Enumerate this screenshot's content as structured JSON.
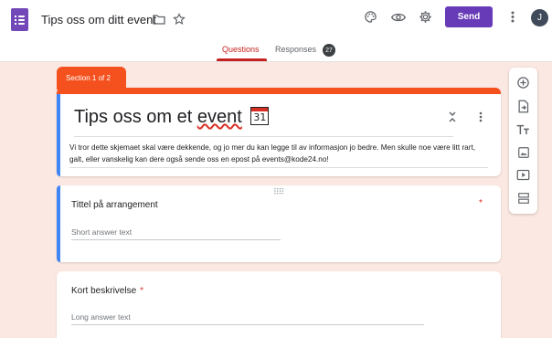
{
  "header": {
    "form_title": "Tips oss om ditt event",
    "send_label": "Send",
    "avatar_letter": "J"
  },
  "tabs": [
    {
      "label": "Questions",
      "active": true
    },
    {
      "label": "Responses",
      "active": false,
      "count": "27"
    }
  ],
  "section": {
    "label": "Section 1 of 2",
    "title_part1": "Tips oss om et",
    "title_part2": "event",
    "calendar_day": "31",
    "description": "Vi tror dette skjemaet skal være dekkende, og jo mer du kan legge til av informasjon jo bedre. Men skulle noe være litt rart, galt, eller vanskelig kan dere også sende oss en epost på events@kode24.no!"
  },
  "questions": [
    {
      "title": "Tittel på arrangement",
      "required": true,
      "hint": "Short answer text"
    },
    {
      "title": "Kort beskrivelse",
      "required": true,
      "hint": "Long answer text"
    }
  ],
  "required_marker": "*",
  "colors": {
    "theme": "#f4511e",
    "active_tab": "#c5221f",
    "send_button": "#673ab7",
    "focus_accent": "#4285f4",
    "background": "#fce8e2"
  },
  "icons": [
    "forms-app-icon",
    "folder-icon",
    "star-icon",
    "palette-icon",
    "eye-preview-icon",
    "gear-icon",
    "more-vert-icon",
    "collapse-icon",
    "add-question-icon",
    "import-questions-icon",
    "add-title-icon",
    "add-image-icon",
    "add-video-icon",
    "add-section-icon"
  ]
}
